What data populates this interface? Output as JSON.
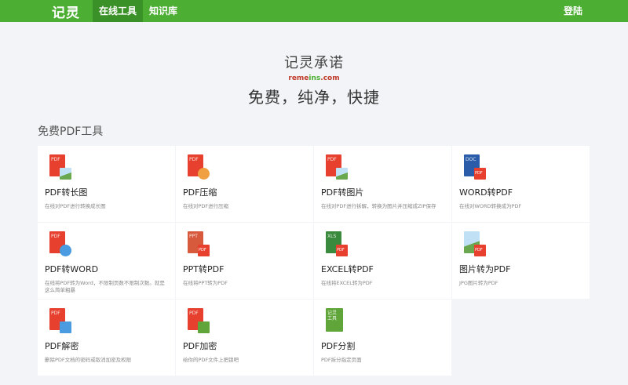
{
  "header": {
    "logo": "记灵",
    "nav": [
      "在线工具",
      "知识库"
    ],
    "login": "登陆"
  },
  "hero": {
    "title": "记灵承诺",
    "domain_left": "reme",
    "domain_mid": "ins",
    "domain_right": ".com",
    "slogan": "免费，纯净，快捷"
  },
  "section": {
    "title": "免费PDF工具"
  },
  "tools": [
    {
      "name": "PDF转长图",
      "desc": "在线对PDF进行转换成长图",
      "icon": "pdf-to-long-image-icon"
    },
    {
      "name": "PDF压缩",
      "desc": "在线对PDF进行压缩",
      "icon": "pdf-compress-icon"
    },
    {
      "name": "PDF转图片",
      "desc": "在线对PDF进行拆解，转换为图片并压缩成ZIP保存",
      "icon": "pdf-to-image-icon"
    },
    {
      "name": "WORD转PDF",
      "desc": "在线对WORD转换成为PDF",
      "icon": "word-to-pdf-icon"
    },
    {
      "name": "PDF转WORD",
      "desc": "在线将PDF转为Word，不限制页数不限制次数。就是这么简单粗暴",
      "icon": "pdf-to-word-icon"
    },
    {
      "name": "PPT转PDF",
      "desc": "在线将PPT转为PDF",
      "icon": "ppt-to-pdf-icon"
    },
    {
      "name": "EXCEL转PDF",
      "desc": "在线将EXCEL转为PDF",
      "icon": "excel-to-pdf-icon"
    },
    {
      "name": "图片转为PDF",
      "desc": "JPG图片转为PDF",
      "icon": "image-to-pdf-icon"
    },
    {
      "name": "PDF解密",
      "desc": "删除PDF文档的密码或取消加密及权限",
      "icon": "pdf-decrypt-icon"
    },
    {
      "name": "PDF加密",
      "desc": "给你的PDF文件上把锁吧",
      "icon": "pdf-encrypt-icon"
    },
    {
      "name": "PDF分割",
      "desc": "PDF拆分指定页面",
      "icon": "pdf-split-icon"
    }
  ],
  "icon_labels": {
    "pdf": "PDF",
    "doc": "DOC",
    "ppt": "PPT",
    "xls": "XLS",
    "jiling": "记灵工具"
  },
  "colors": {
    "brand": "#4cae32",
    "nav_active": "#3a9127",
    "pdf_red": "#e7402e"
  }
}
